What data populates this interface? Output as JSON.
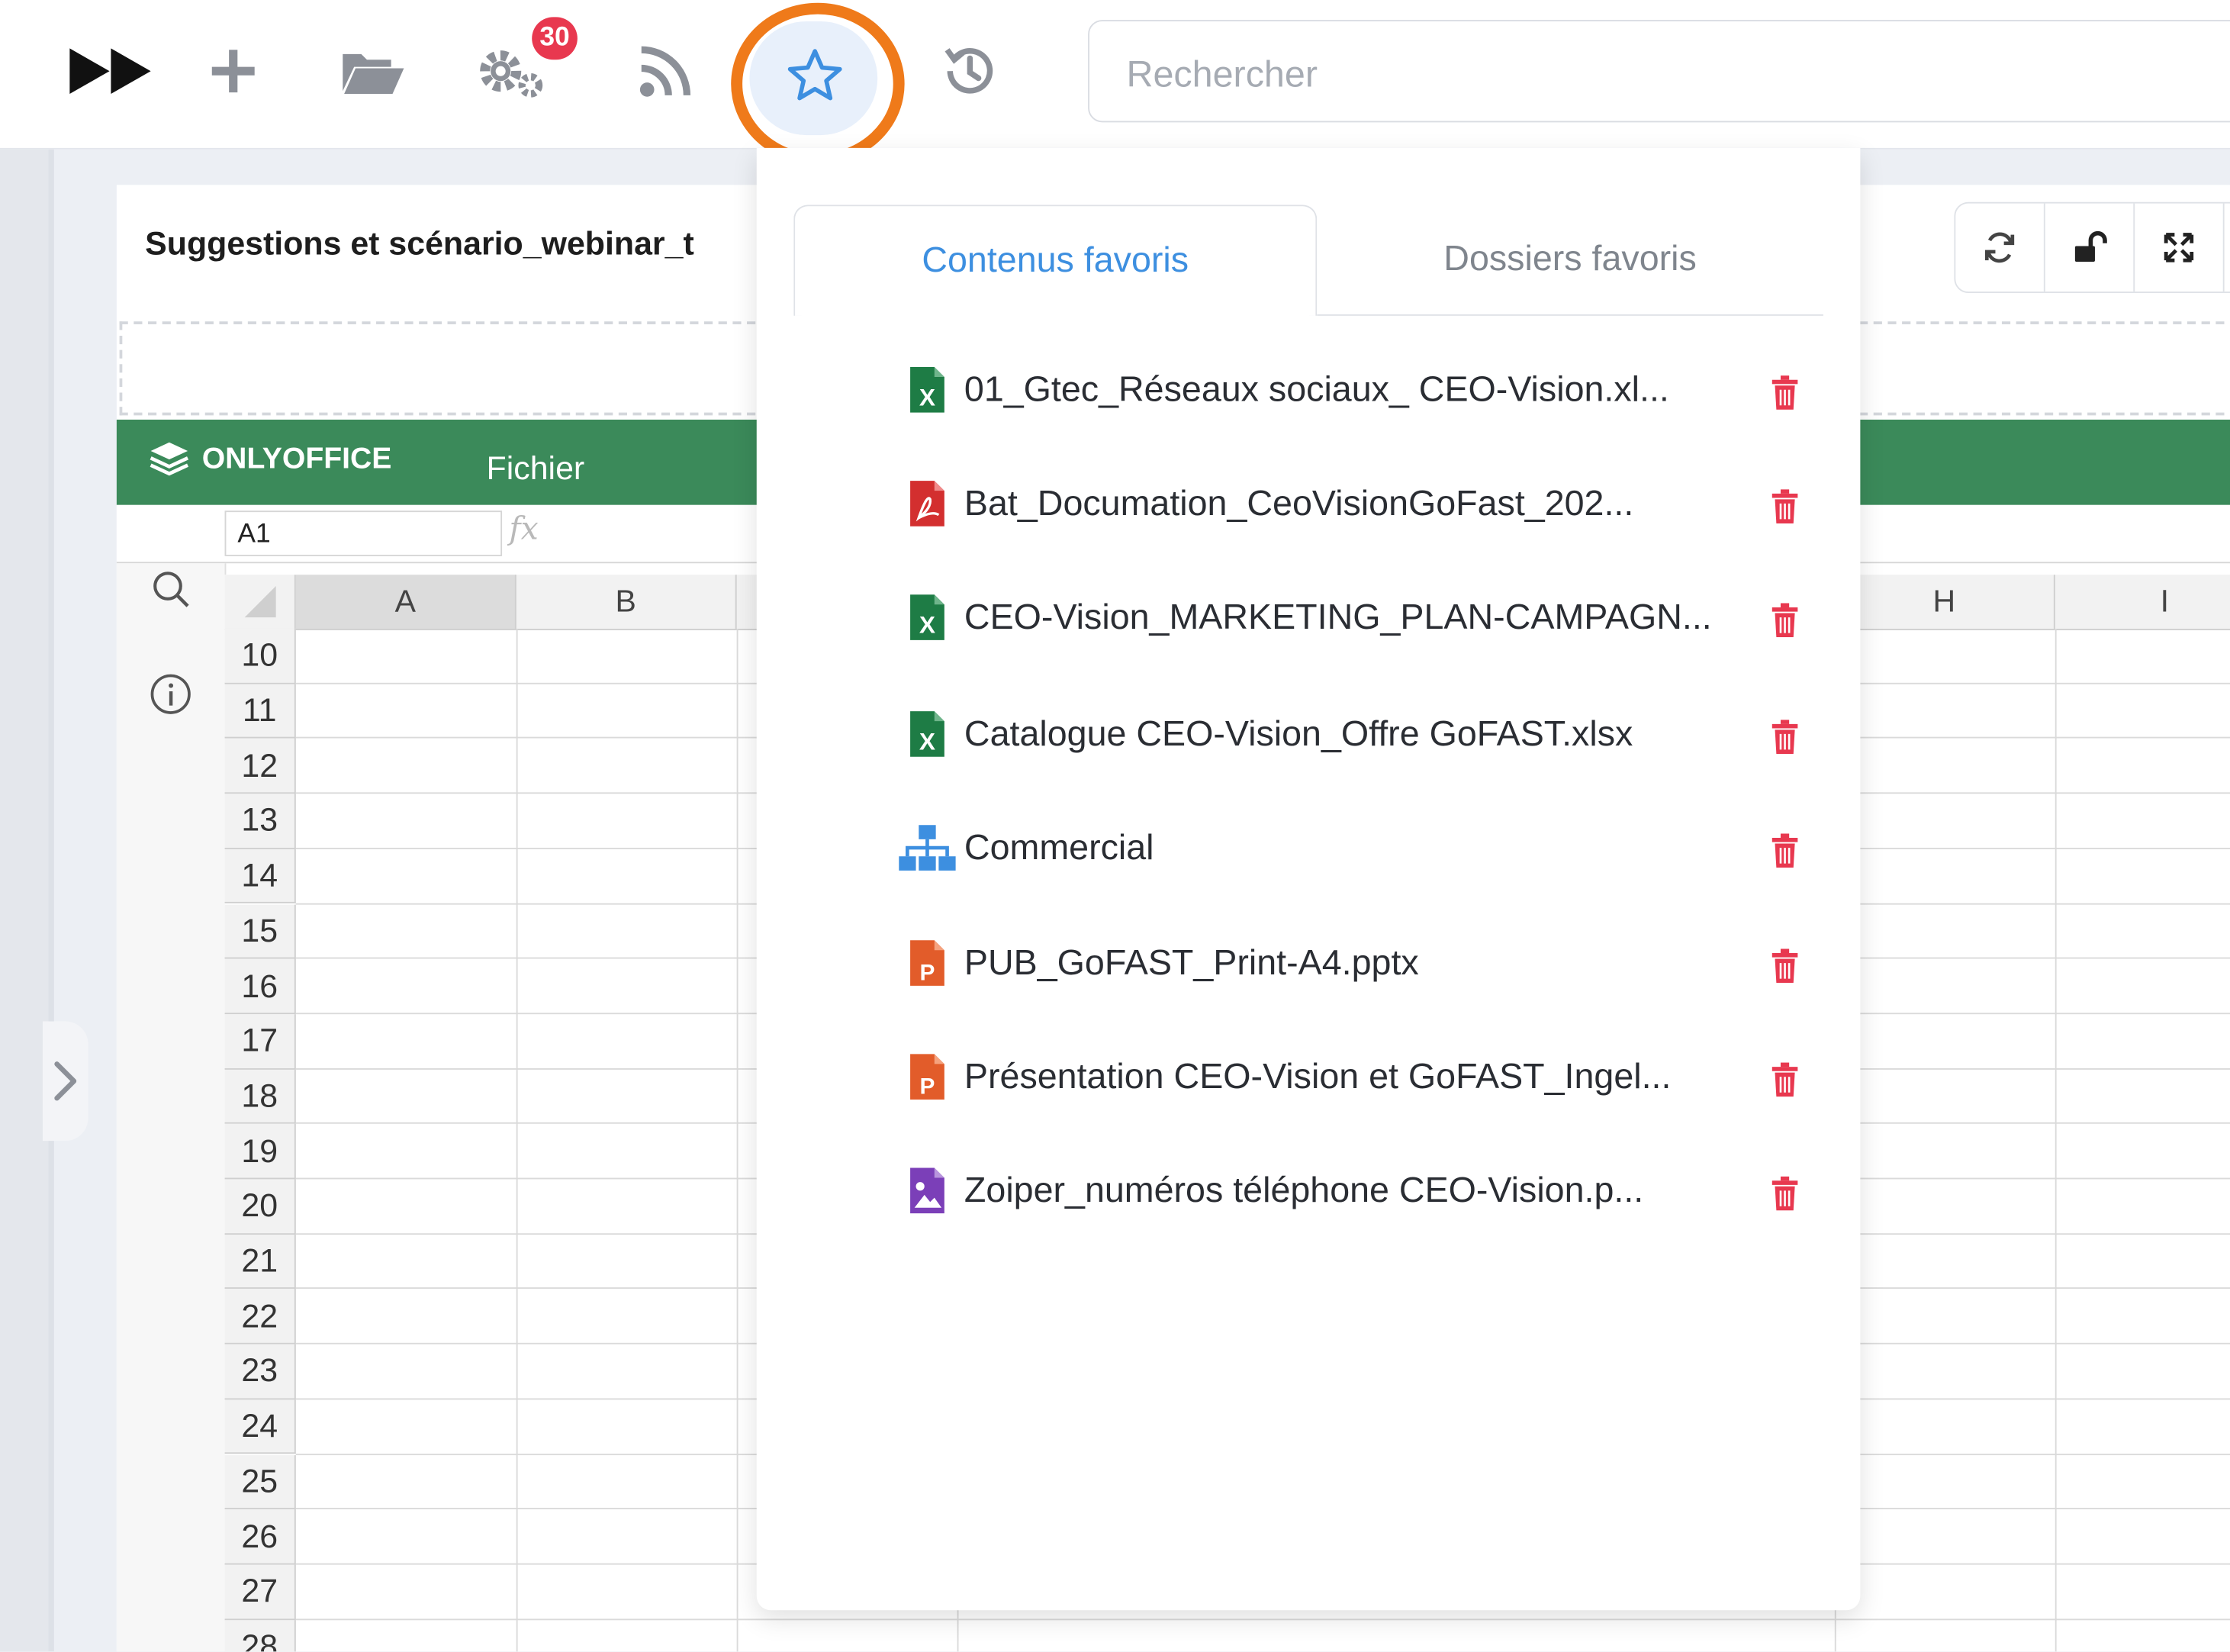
{
  "toolbar": {
    "notification_count": "30",
    "search_placeholder": "Rechercher"
  },
  "document": {
    "title": "Suggestions et scénario_webinar_t",
    "app_name": "ONLYOFFICE",
    "menu_fichier": "Fichier",
    "cell_ref": "A1",
    "fx_label": "fx"
  },
  "sheet": {
    "columns": [
      "A",
      "B",
      "H",
      "I"
    ],
    "rows": [
      "10",
      "11",
      "12",
      "13",
      "14",
      "15",
      "16",
      "17",
      "18",
      "19",
      "20",
      "21",
      "22",
      "23",
      "24",
      "25",
      "26",
      "27",
      "28"
    ]
  },
  "favorites": {
    "tab_contents": "Contenus favoris",
    "tab_folders": "Dossiers favoris",
    "items": [
      {
        "type": "xlsx",
        "label": "01_Gtec_Réseaux sociaux_ CEO-Vision.xl..."
      },
      {
        "type": "pdf",
        "label": "Bat_Documation_CeoVisionGoFast_202..."
      },
      {
        "type": "xlsx",
        "label": "CEO-Vision_MARKETING_PLAN-CAMPAGN..."
      },
      {
        "type": "xlsx",
        "label": "Catalogue CEO-Vision_Offre GoFAST.xlsx"
      },
      {
        "type": "folder",
        "label": "Commercial"
      },
      {
        "type": "pptx",
        "label": "PUB_GoFAST_Print-A4.pptx"
      },
      {
        "type": "pptx",
        "label": "Présentation CEO-Vision et GoFAST_Ingel..."
      },
      {
        "type": "image",
        "label": "Zoiper_numéros téléphone CEO-Vision.p..."
      }
    ]
  },
  "colors": {
    "accent": "#3d8fe0",
    "highlight_ring": "#ef7a1a",
    "onlyoffice_green": "#3b8a5a",
    "delete_red": "#e8384f"
  }
}
